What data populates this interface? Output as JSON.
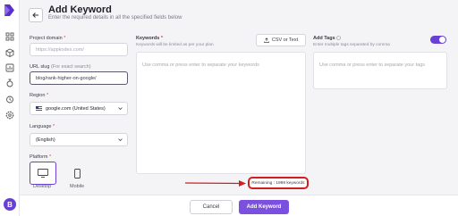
{
  "header": {
    "title": "Add Keyword",
    "subtitle": "Enter the required details in all the specified fields below"
  },
  "sidebar": {
    "avatar_initial": "B",
    "icons": [
      "grid-icon",
      "box-icon",
      "chart-icon",
      "tools-icon",
      "timer-icon",
      "settings-icon"
    ]
  },
  "form": {
    "domain": {
      "label": "Project domain",
      "required": "*",
      "placeholder": "https://appkodes.com/"
    },
    "slug": {
      "label": "URL slug",
      "hint": "(For exact search)",
      "value": "blog/rank-higher-on-google/"
    },
    "region": {
      "label": "Region",
      "required": "*",
      "value": "google.com (United States)"
    },
    "language": {
      "label": "Language",
      "required": "*",
      "value": "(English)"
    },
    "platform": {
      "label": "Platform",
      "required": "*",
      "options": [
        "Desktop",
        "Mobile"
      ],
      "selected": "Desktop"
    }
  },
  "keywords": {
    "label": "Keywords",
    "required": "*",
    "hint": "Keywords will be limited as per your plan",
    "csv_button": "CSV or Text",
    "placeholder": "Use comma or press enter to separate your keywords",
    "remaining": "Remaining : 1998 keywords"
  },
  "tags": {
    "label": "Add Tags",
    "hint": "Enter multiple tags separated by comma",
    "placeholder": "Use comma or press enter to separate your tags",
    "toggle_on": true
  },
  "footer": {
    "cancel_label": "Cancel",
    "submit_label": "Add Keyword"
  },
  "colors": {
    "accent": "#7b4fdf",
    "highlight": "#d11f1f"
  }
}
